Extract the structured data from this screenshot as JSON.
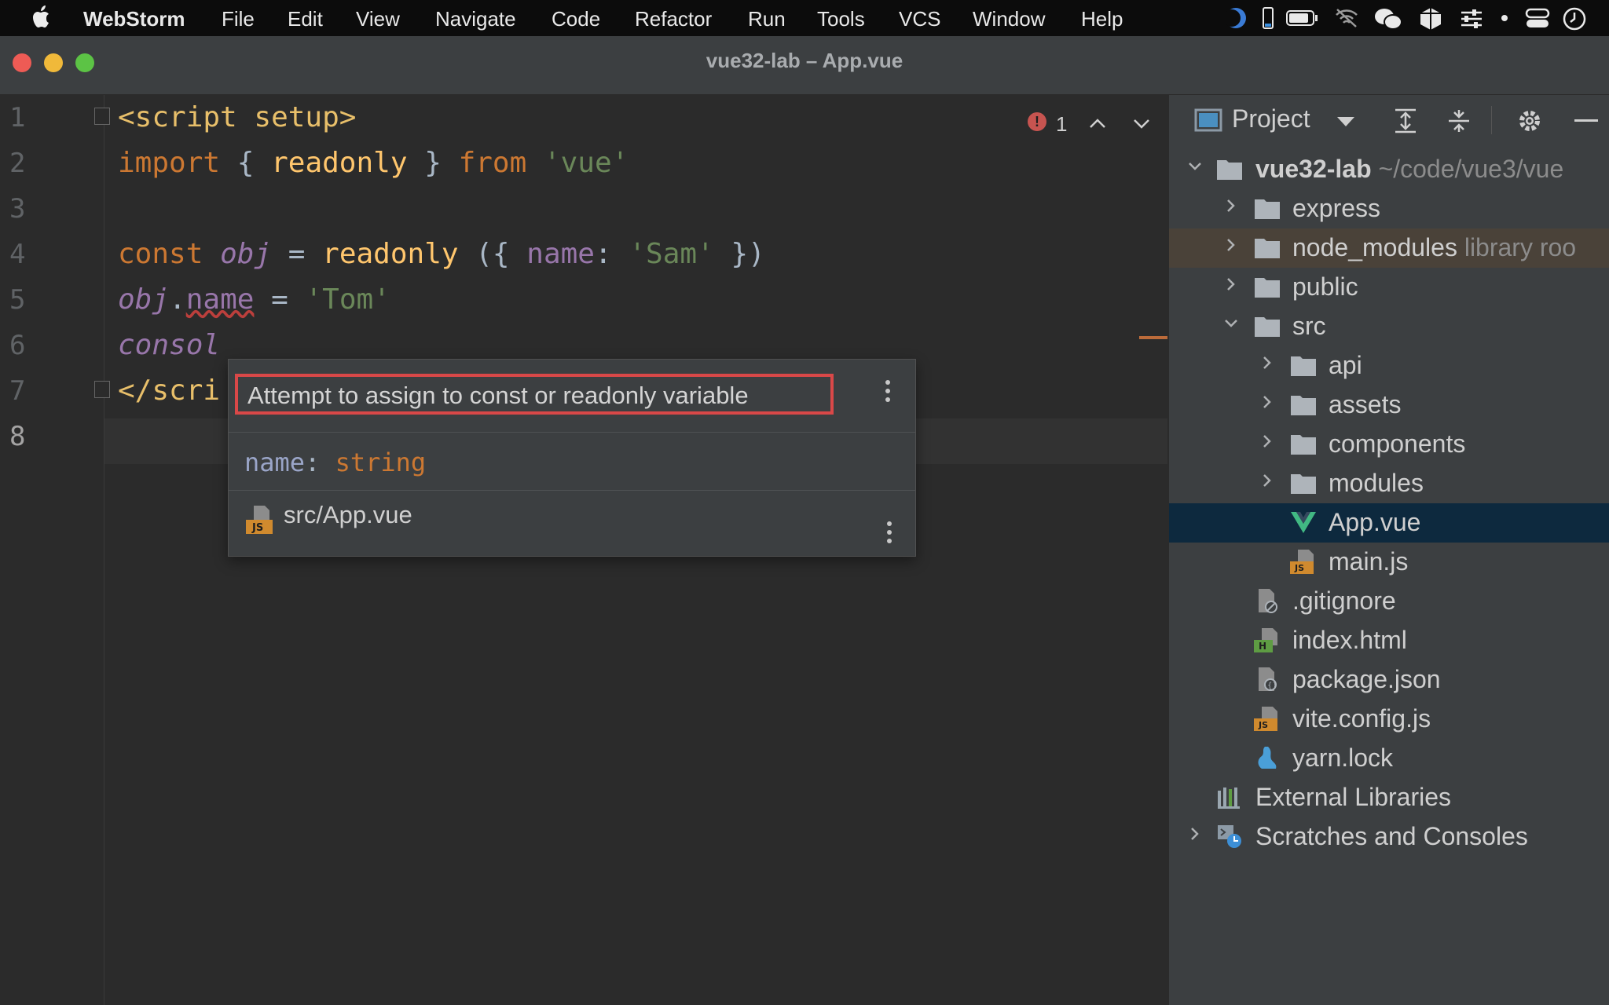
{
  "menubar": {
    "app": "WebStorm",
    "items": [
      "File",
      "Edit",
      "View",
      "Navigate",
      "Code",
      "Refactor",
      "Run",
      "Tools",
      "VCS",
      "Window",
      "Help"
    ]
  },
  "window": {
    "title": "vue32-lab – App.vue"
  },
  "editor": {
    "line_numbers": [
      "1",
      "2",
      "3",
      "4",
      "5",
      "6",
      "7",
      "8"
    ],
    "code": {
      "l1_tag": "<script setup>",
      "l2_import": "import",
      "l2_brace_open": "{",
      "l2_fn": "readonly",
      "l2_brace_close": "}",
      "l2_from": "from",
      "l2_str": "'vue'",
      "l4_const": "const",
      "l4_var": "obj",
      "l4_eq": "=",
      "l4_fn": "readonly",
      "l4_open": "({",
      "l4_prop": "name",
      "l4_colon": ":",
      "l4_str": "'Sam'",
      "l4_close": "})",
      "l5_var": "obj",
      "l5_dot": ".",
      "l5_prop": "name",
      "l5_eq": "=",
      "l5_str": "'Tom'",
      "l6_partial": "consol",
      "l7_partial": "</scri"
    },
    "inspection_count": "1"
  },
  "popup": {
    "message": "Attempt to assign to const or readonly variable",
    "type_name": "name",
    "type_colon": ":",
    "type_value": "string",
    "file": "src/App.vue"
  },
  "project": {
    "title": "Project",
    "tree": [
      {
        "label": "vue32-lab",
        "hint": "~/code/vue3/vue"
      },
      {
        "label": "express"
      },
      {
        "label": "node_modules",
        "hint": "library roo"
      },
      {
        "label": "public"
      },
      {
        "label": "src"
      },
      {
        "label": "api"
      },
      {
        "label": "assets"
      },
      {
        "label": "components"
      },
      {
        "label": "modules"
      },
      {
        "label": "App.vue"
      },
      {
        "label": "main.js"
      },
      {
        "label": ".gitignore"
      },
      {
        "label": "index.html"
      },
      {
        "label": "package.json"
      },
      {
        "label": "vite.config.js"
      },
      {
        "label": "yarn.lock"
      },
      {
        "label": "External Libraries"
      },
      {
        "label": "Scratches and Consoles"
      }
    ]
  },
  "colors": {
    "keyword": "#cc7832",
    "tag": "#e8bf6a",
    "function": "#ffc66d",
    "string": "#6a8759",
    "variable": "#9876aa",
    "error": "#d94848",
    "selection": "#0d293e"
  }
}
